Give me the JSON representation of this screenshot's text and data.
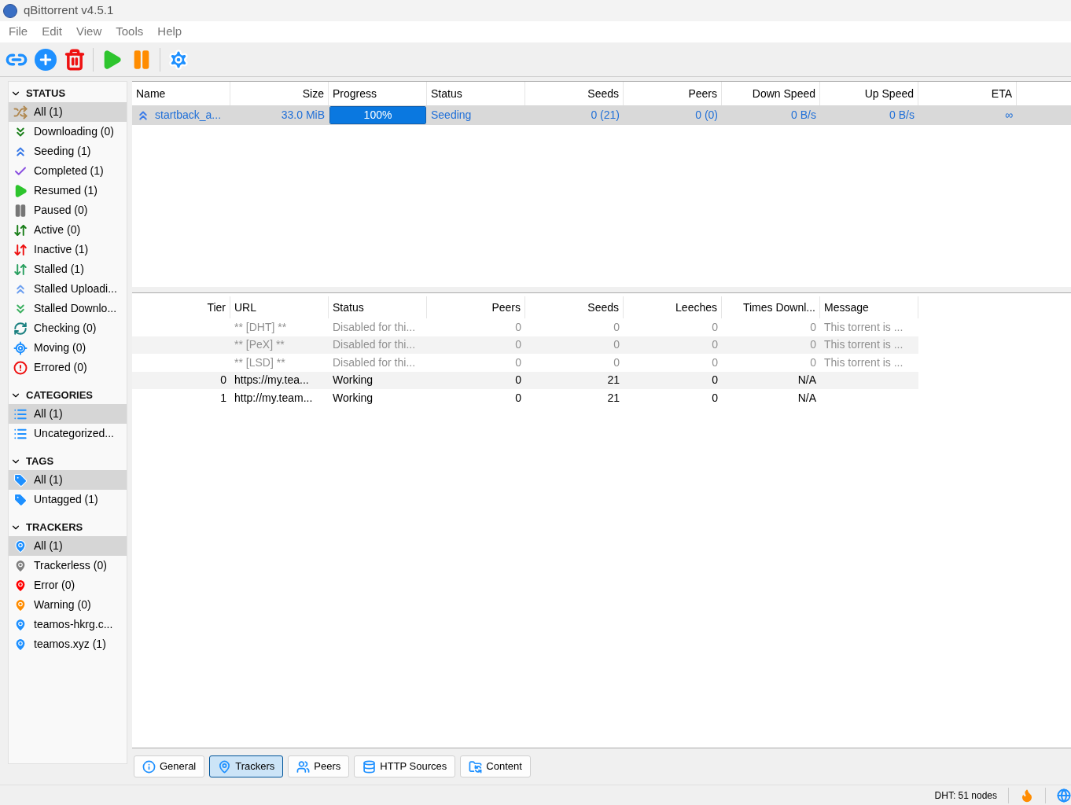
{
  "window": {
    "title": "qBittorrent v4.5.1"
  },
  "menu": [
    "File",
    "Edit",
    "View",
    "Tools",
    "Help"
  ],
  "sidebar": [
    {
      "title": "STATUS",
      "expanded": true,
      "items": [
        {
          "label": "All (1)",
          "selected": true
        },
        {
          "label": "Downloading (0)",
          "selected": false
        },
        {
          "label": "Seeding (1)",
          "selected": false
        },
        {
          "label": "Completed (1)",
          "selected": false
        },
        {
          "label": "Resumed (1)",
          "selected": false
        },
        {
          "label": "Paused (0)",
          "selected": false
        },
        {
          "label": "Active (0)",
          "selected": false
        },
        {
          "label": "Inactive (1)",
          "selected": false
        },
        {
          "label": "Stalled (1)",
          "selected": false
        },
        {
          "label": "Stalled Uploadi...",
          "selected": false
        },
        {
          "label": "Stalled Downlo...",
          "selected": false
        },
        {
          "label": "Checking (0)",
          "selected": false
        },
        {
          "label": "Moving (0)",
          "selected": false
        },
        {
          "label": "Errored (0)",
          "selected": false
        }
      ]
    },
    {
      "title": "CATEGORIES",
      "expanded": true,
      "items": [
        {
          "label": "All (1)",
          "selected": true
        },
        {
          "label": "Uncategorized...",
          "selected": false
        }
      ]
    },
    {
      "title": "TAGS",
      "expanded": true,
      "items": [
        {
          "label": "All (1)",
          "selected": true
        },
        {
          "label": "Untagged (1)",
          "selected": false
        }
      ]
    },
    {
      "title": "TRACKERS",
      "expanded": true,
      "items": [
        {
          "label": "All (1)",
          "selected": true,
          "color": "#1e90ff"
        },
        {
          "label": "Trackerless (0)",
          "selected": false,
          "color": "#808080"
        },
        {
          "label": "Error (0)",
          "selected": false,
          "color": "#ff0000"
        },
        {
          "label": "Warning (0)",
          "selected": false,
          "color": "#ff8c00"
        },
        {
          "label": "teamos-hkrg.c...",
          "selected": false,
          "color": "#1e90ff"
        },
        {
          "label": "teamos.xyz (1)",
          "selected": false,
          "color": "#1e90ff"
        }
      ]
    }
  ],
  "torrents": {
    "columns": [
      "Name",
      "Size",
      "Progress",
      "Status",
      "Seeds",
      "Peers",
      "Down Speed",
      "Up Speed",
      "ETA"
    ],
    "rows": [
      {
        "selected": true,
        "name": "startback_a...",
        "size": "33.0 MiB",
        "progress": {
          "level": 1,
          "text": "100%"
        },
        "status": "Seeding",
        "seeds": "0 (21)",
        "peers": "0 (0)",
        "down_speed": "0 B/s",
        "up_speed": "0 B/s",
        "eta": "∞"
      }
    ]
  },
  "trackers": {
    "columns": [
      "Tier",
      "URL",
      "Status",
      "Peers",
      "Seeds",
      "Leeches",
      "Times Downl...",
      "Message"
    ],
    "rows": [
      {
        "disabled": true,
        "cells": [
          "",
          "** [DHT] **",
          "Disabled for thi...",
          "0",
          "0",
          "0",
          "0",
          "This torrent is ..."
        ]
      },
      {
        "disabled": true,
        "cells": [
          "",
          "** [PeX] **",
          "Disabled for thi...",
          "0",
          "0",
          "0",
          "0",
          "This torrent is ..."
        ]
      },
      {
        "disabled": true,
        "cells": [
          "",
          "** [LSD] **",
          "Disabled for thi...",
          "0",
          "0",
          "0",
          "0",
          "This torrent is ..."
        ]
      },
      {
        "disabled": false,
        "cells": [
          "0",
          "https://my.tea...",
          "Working",
          "0",
          "21",
          "0",
          "N/A",
          ""
        ]
      },
      {
        "disabled": false,
        "cells": [
          "1",
          "http://my.team...",
          "Working",
          "0",
          "21",
          "0",
          "N/A",
          ""
        ]
      }
    ]
  },
  "detail_tabs": [
    {
      "label": "General",
      "selected": false
    },
    {
      "label": "Trackers",
      "selected": true
    },
    {
      "label": "Peers",
      "selected": false
    },
    {
      "label": "HTTP Sources",
      "selected": false
    },
    {
      "label": "Content",
      "selected": false
    }
  ],
  "status_bar": {
    "dht": "DHT: 51 nodes"
  }
}
